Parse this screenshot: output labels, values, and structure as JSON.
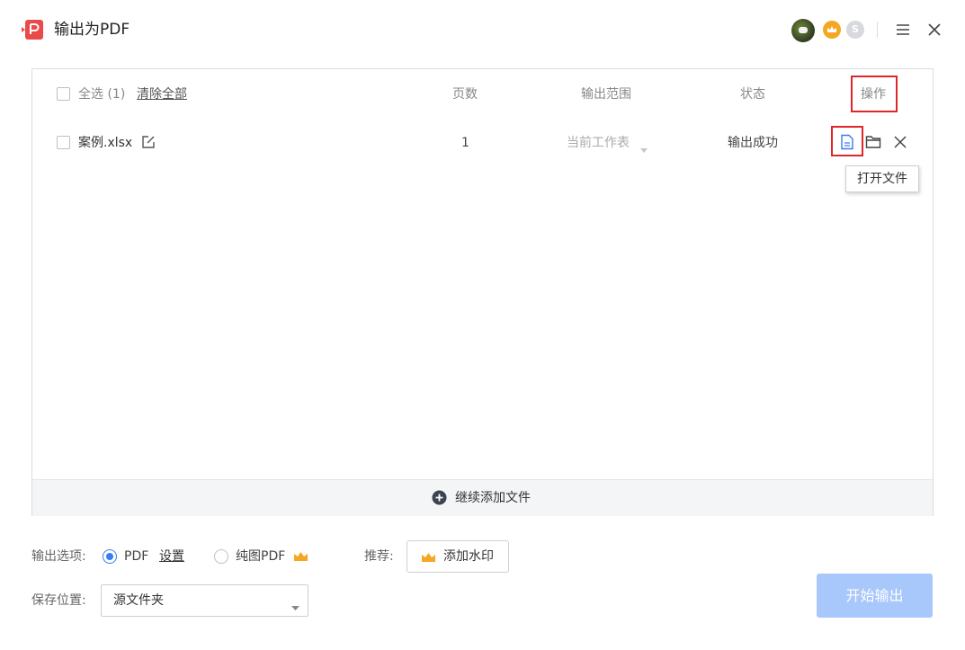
{
  "window": {
    "title": "输出为PDF"
  },
  "user": {
    "vip_badge_letter": "S"
  },
  "table": {
    "select_all": "全选 (1)",
    "clear_all": "清除全部",
    "columns": {
      "pages": "页数",
      "range": "输出范围",
      "status": "状态",
      "actions": "操作"
    },
    "rows": [
      {
        "filename": "案例.xlsx",
        "pages": "1",
        "range": "当前工作表",
        "status": "输出成功"
      }
    ],
    "tooltip": "打开文件",
    "add_more": "继续添加文件"
  },
  "options": {
    "label": "输出选项:",
    "pdf": "PDF",
    "settings": "设置",
    "image_pdf": "纯图PDF",
    "recommend_label": "推荐:",
    "watermark_button": "添加水印"
  },
  "save": {
    "label": "保存位置:",
    "location": "源文件夹"
  },
  "start_button": "开始输出",
  "colors": {
    "accent": "#3a7bf2",
    "highlight": "#e0262a",
    "crown": "#f5a623",
    "start_disabled": "#a8c7fb"
  }
}
